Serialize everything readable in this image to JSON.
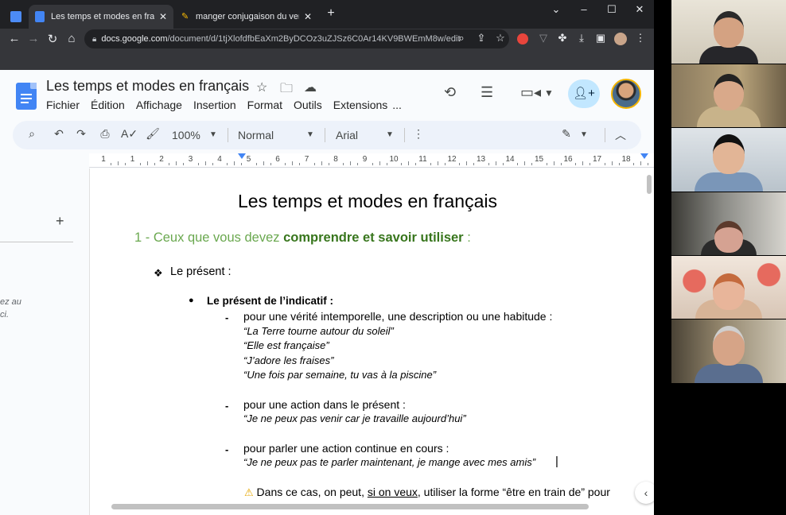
{
  "browser": {
    "tabs": [
      {
        "title": "",
        "icon": "meet-icon"
      },
      {
        "title": "Les temps et modes en français",
        "icon": "docs-icon",
        "active": true
      },
      {
        "title": "manger conjugaison du verbe m",
        "icon": "bookmark-icon"
      }
    ],
    "new_tab_label": "+",
    "window_controls": [
      "⌄",
      "–",
      "☐",
      "✕"
    ],
    "url_host": "docs.google.com",
    "url_path": "/document/d/1tjXlofdfbEaXm2ByDCOz3uZJSz6C0Ar14KV9BWEmM8w/edit"
  },
  "docs": {
    "title": "Les temps et modes en français",
    "menu": [
      "Fichier",
      "Édition",
      "Affichage",
      "Insertion",
      "Format",
      "Outils",
      "Extensions",
      "..."
    ],
    "zoom": "100%",
    "style": "Normal",
    "font": "Arial",
    "ruler_numbers": [
      "1",
      "1",
      "2",
      "3",
      "4",
      "5",
      "6",
      "7",
      "8",
      "9",
      "10",
      "11",
      "12",
      "13",
      "14",
      "15",
      "16",
      "17",
      "18"
    ],
    "side_plus": "+",
    "side_hint_1": "ez au",
    "side_hint_2": "ci."
  },
  "document": {
    "heading": "Les temps et modes en français",
    "section_prefix": "1 - Ceux que vous devez ",
    "section_bold": "comprendre et savoir utiliser",
    "section_suffix": " :",
    "present_label": "Le présent :",
    "indicatif_label": "Le présent de l’indicatif :",
    "use1": "pour une vérité intemporelle, une description ou une habitude :",
    "ex1": "“La Terre tourne autour du soleil”",
    "ex2": "“Elle est française”",
    "ex3": "“J’adore les fraises”",
    "ex4": "“Une fois par semaine, tu vas à la piscine”",
    "use2": "pour une action dans le présent :",
    "ex5": "“Je ne peux pas venir car je travaille aujourd’hui”",
    "use3": "pour parler une action continue en cours :",
    "ex6": "“Je ne peux pas te parler maintenant, je mange avec mes amis”",
    "warn_pre": "Dans ce cas, on peut, ",
    "warn_u": "si on veux",
    "warn_post": ", utiliser la forme “être en train de” pour"
  }
}
